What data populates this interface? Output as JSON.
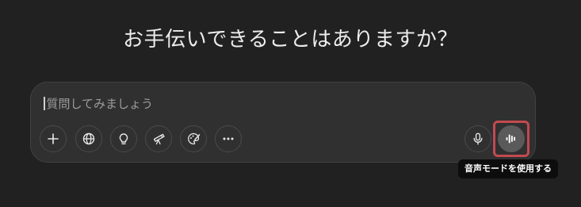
{
  "heading": "お手伝いできることはありますか？",
  "composer": {
    "placeholder": "質問してみましょう",
    "tools": [
      {
        "icon": "plus-icon"
      },
      {
        "icon": "globe-icon"
      },
      {
        "icon": "lightbulb-icon"
      },
      {
        "icon": "telescope-icon"
      },
      {
        "icon": "paint-palette-icon"
      },
      {
        "icon": "more-dots-icon"
      }
    ],
    "mic_icon": "microphone-icon",
    "voice_icon": "voice-waveform-icon"
  },
  "tooltip": {
    "voice_mode": "音声モードを使用する"
  },
  "colors": {
    "background": "#212121",
    "composer": "#303030",
    "highlight": "#c24a50",
    "tooltip": "#0d0d0d"
  }
}
